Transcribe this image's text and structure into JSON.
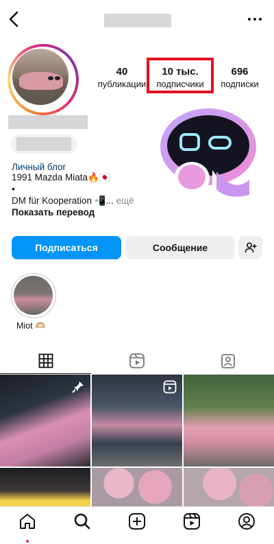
{
  "header": {
    "username": ""
  },
  "profile": {
    "stats": [
      {
        "num": "40",
        "label": "публикации"
      },
      {
        "num": "10 тыс.",
        "label": "подписчики"
      },
      {
        "num": "696",
        "label": "подписки"
      }
    ],
    "category": "Личный блог",
    "bio_line1": "1991 Mazda Miata🔥🇯🇵",
    "bio_dot": "•",
    "bio_line2": "DM für Kooperation 📲...",
    "bio_more": " ещё",
    "translate": "Показать перевод"
  },
  "buttons": {
    "follow": "Подписаться",
    "message": "Сообщение"
  },
  "highlights": [
    {
      "label": "Miot 🫶🏼"
    }
  ],
  "colors": {
    "accent": "#0095f6",
    "highlight_box": "#e3101c",
    "category": "#00376b"
  },
  "icons": {
    "back": "chevron-left-icon",
    "more": "more-horizontal-icon",
    "add_user": "add-user-icon",
    "tab_grid": "grid-icon",
    "tab_reels": "reels-icon",
    "tab_tagged": "tagged-icon",
    "nav": [
      "home-icon",
      "search-icon",
      "create-icon",
      "reels-icon",
      "profile-icon"
    ]
  }
}
